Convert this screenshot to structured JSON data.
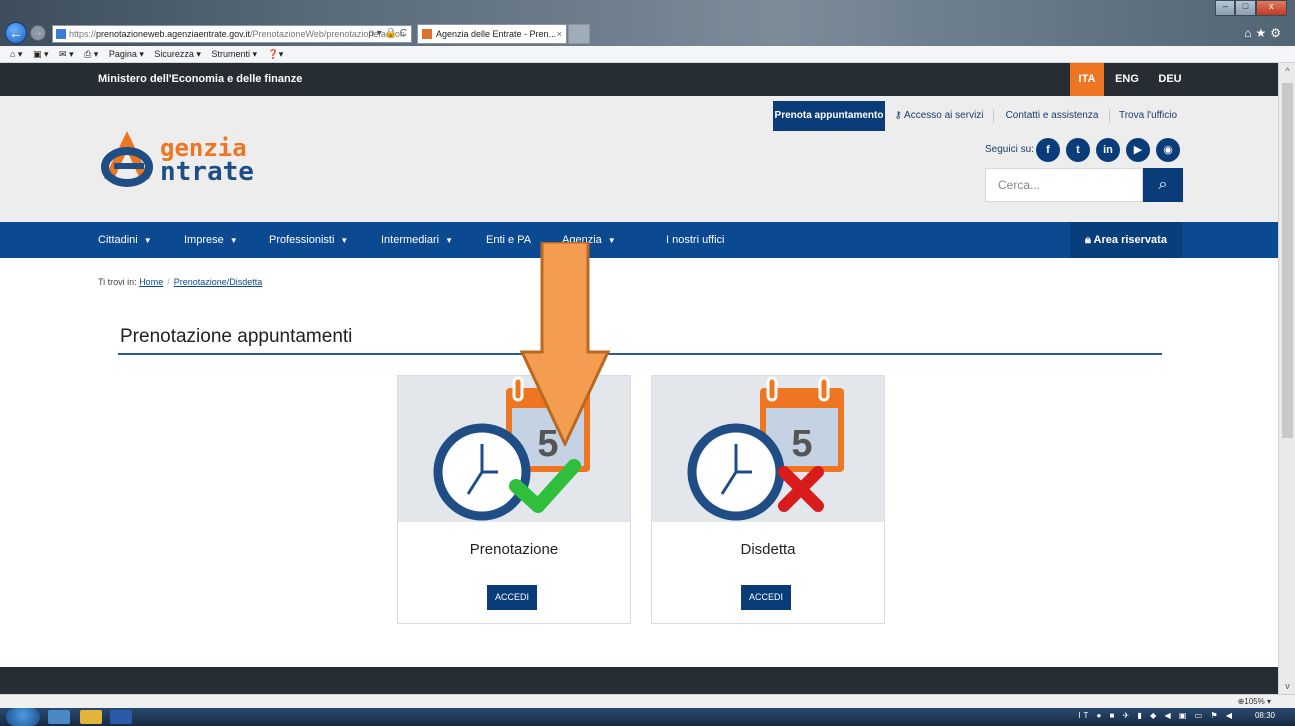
{
  "browser": {
    "url_prefix": "https://",
    "url_host": "prenotazioneweb.agenziaentrate.gov.it",
    "url_path": "/PrenotazioneWeb/prenotazione.action",
    "addr_tools": "ρ ▾ 🔒 C",
    "tab_title": "Agenzia delle Entrate - Pren...",
    "tab_close": "×",
    "cmdbar": [
      "Pagina ▾",
      "Sicurezza ▾",
      "Strumenti ▾"
    ],
    "status_zoom": "105%",
    "clock": "08:30",
    "tray_lang": "IT"
  },
  "topbar": {
    "ministry": "Ministero dell'Economia e delle finanze",
    "languages": [
      "ITA",
      "ENG",
      "DEU"
    ],
    "active_language": "ITA",
    "accent_color": "#ee7623"
  },
  "logo": {
    "line1": "genzia",
    "line2": "ntrate"
  },
  "utility_nav": {
    "prenota": "Prenota appuntamento",
    "accesso": "Accesso ai servizi",
    "contatti": "Contatti e assistenza",
    "trova": "Trova l'ufficio"
  },
  "social": {
    "label": "Seguici su:",
    "icons": [
      "f",
      "t",
      "in",
      "yt",
      "rss"
    ]
  },
  "search": {
    "placeholder": "Cerca..."
  },
  "mainnav": {
    "cittadini": "Cittadini",
    "imprese": "Imprese",
    "professionisti": "Professionisti",
    "intermediari": "Intermediari",
    "enti": "Enti e PA",
    "agenzia": "Agenzia",
    "uffici": "I nostri uffici",
    "area_riservata": "Area riservata",
    "brand_color": "#0b4a91"
  },
  "breadcrumb": {
    "prefix": "Ti trovi in:",
    "home": "Home",
    "current": "Prenotazione/Disdetta"
  },
  "page": {
    "title": "Prenotazione appuntamenti"
  },
  "cards": [
    {
      "title": "Prenotazione",
      "button": "ACCEDI",
      "calendar_day": "5",
      "status": "check"
    },
    {
      "title": "Disdetta",
      "button": "ACCEDI",
      "calendar_day": "5",
      "status": "cross"
    }
  ]
}
